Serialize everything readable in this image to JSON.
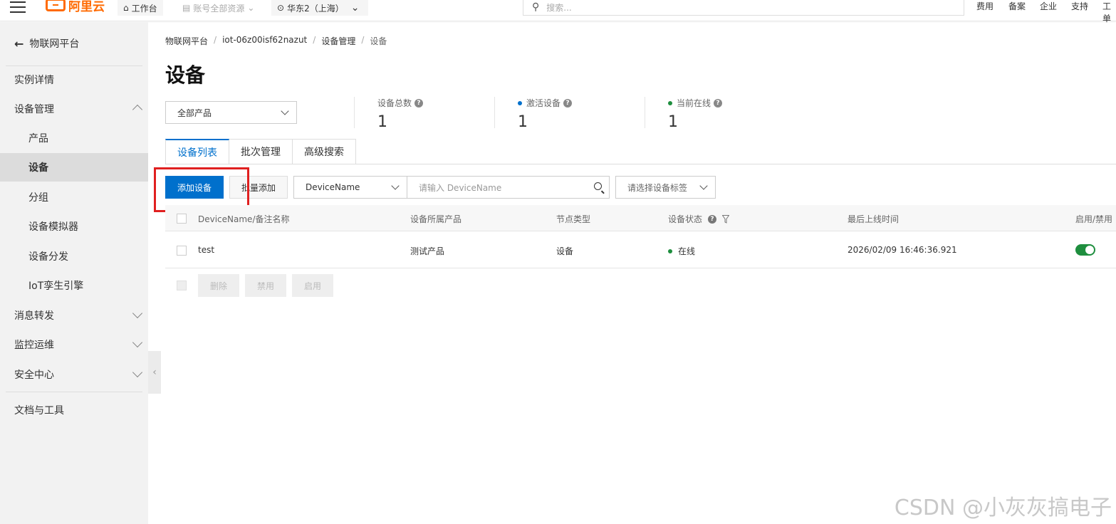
{
  "topbar": {
    "logo_text": "阿里云",
    "workbench": "工作台",
    "account_resources": "账号全部资源",
    "region": "华东2（上海）",
    "search_placeholder": "搜索...",
    "links": [
      "费用",
      "备案",
      "企业",
      "支持",
      "工单"
    ]
  },
  "sidebar": {
    "back_label": "物联网平台",
    "items": [
      {
        "label": "实例详情",
        "level": 1
      },
      {
        "label": "设备管理",
        "level": 1,
        "expanded": true
      },
      {
        "label": "产品",
        "level": 2
      },
      {
        "label": "设备",
        "level": 2,
        "active": true
      },
      {
        "label": "分组",
        "level": 2
      },
      {
        "label": "设备模拟器",
        "level": 2
      },
      {
        "label": "设备分发",
        "level": 2
      },
      {
        "label": "IoT孪生引擎",
        "level": 2
      },
      {
        "label": "消息转发",
        "level": 1,
        "expanded": false
      },
      {
        "label": "监控运维",
        "level": 1,
        "expanded": false
      },
      {
        "label": "安全中心",
        "level": 1,
        "expanded": false
      }
    ],
    "docs": "文档与工具"
  },
  "breadcrumb": [
    "物联网平台",
    "iot-06z00isf62nazut",
    "设备管理",
    "设备"
  ],
  "page_title": "设备",
  "product_filter": "全部产品",
  "stats": [
    {
      "label": "设备总数",
      "value": "1",
      "dot_color": ""
    },
    {
      "label": "激活设备",
      "value": "1",
      "dot_color": "#0070cc"
    },
    {
      "label": "当前在线",
      "value": "1",
      "dot_color": "#1e8e3e"
    }
  ],
  "tabs": [
    {
      "label": "设备列表",
      "active": true
    },
    {
      "label": "批次管理",
      "active": false
    },
    {
      "label": "高级搜索",
      "active": false
    }
  ],
  "toolbar": {
    "add_device": "添加设备",
    "batch_add": "批量添加",
    "search_field": "DeviceName",
    "search_placeholder": "请输入 DeviceName",
    "tag_placeholder": "请选择设备标签"
  },
  "table": {
    "headers": [
      "DeviceName/备注名称",
      "设备所属产品",
      "节点类型",
      "设备状态",
      "最后上线时间",
      "启用/禁用"
    ],
    "rows": [
      {
        "name": "test",
        "product": "测试产品",
        "node_type": "设备",
        "status": "在线",
        "last_online": "2026/02/09 16:46:36.921",
        "enabled": true
      }
    ]
  },
  "bulk_actions": [
    "删除",
    "禁用",
    "启用"
  ],
  "colors": {
    "primary": "#0070cc",
    "online": "#1e8e3e",
    "highlight": "#e02020",
    "brand": "#ff6a00"
  },
  "watermark": "CSDN @小灰灰搞电子"
}
